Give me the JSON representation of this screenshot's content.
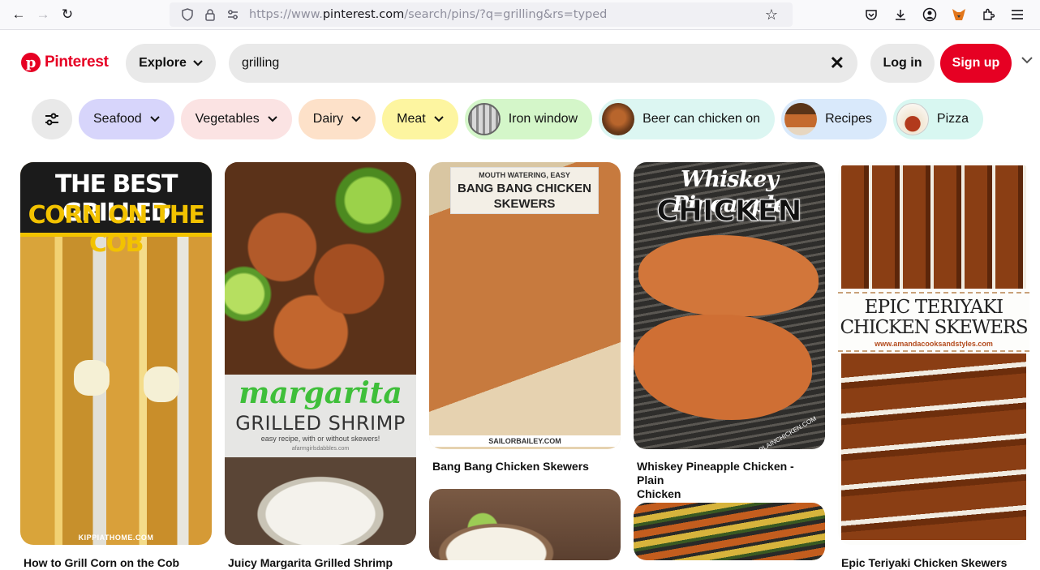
{
  "browser": {
    "url_prefix": "https://www.",
    "url_domain": "pinterest.com",
    "url_rest": "/search/pins/?q=grilling&rs=typed"
  },
  "header": {
    "logo_text": "Pinterest",
    "explore_label": "Explore",
    "search_value": "grilling",
    "login_label": "Log in",
    "signup_label": "Sign up"
  },
  "filters": [
    {
      "label": "Seafood",
      "color": "#d7d5fb"
    },
    {
      "label": "Vegetables",
      "color": "#fbe3e3"
    },
    {
      "label": "Dairy",
      "color": "#fde1c9"
    },
    {
      "label": "Meat",
      "color": "#fdf5a0"
    },
    {
      "label": "Iron window",
      "color": "#d4f6c9"
    },
    {
      "label": "Beer can chicken on",
      "color": "#dcf6f2"
    },
    {
      "label": "Recipes",
      "color": "#d9e9fb"
    },
    {
      "label": "Pizza",
      "color": "#d8f7f1"
    }
  ],
  "pins": {
    "corn": {
      "line1": "THE BEST GRILLED",
      "line2": "CORN ON THE COB",
      "source": "KIPPIATHOME.COM",
      "title": "How to Grill Corn on the Cob"
    },
    "shrimp": {
      "script": "margarita",
      "line": "GRILLED SHRIMP",
      "sub": "easy recipe, with or without skewers!",
      "source": "afarmgirlsdabbles.com",
      "title": "Juicy Margarita Grilled Shrimp"
    },
    "bangbang": {
      "top": "MOUTH WATERING, EASY",
      "line1": "BANG BANG CHICKEN",
      "line2": "SKEWERS",
      "source": "SAILORBAILEY.COM",
      "title": "Bang Bang Chicken Skewers"
    },
    "whiskey": {
      "script": "Whiskey Pineapple",
      "line": "CHICKEN",
      "source": "PLAINCHICKEN.COM",
      "title_line1": "Whiskey Pineapple Chicken - Plain",
      "title_line2": "Chicken"
    },
    "teriyaki": {
      "line1": "EPIC TERIYAKI",
      "line2": "CHICKEN SKEWERS",
      "site": "www.amandacooksandstyles.com",
      "title": "Epic Teriyaki Chicken Skewers"
    }
  }
}
